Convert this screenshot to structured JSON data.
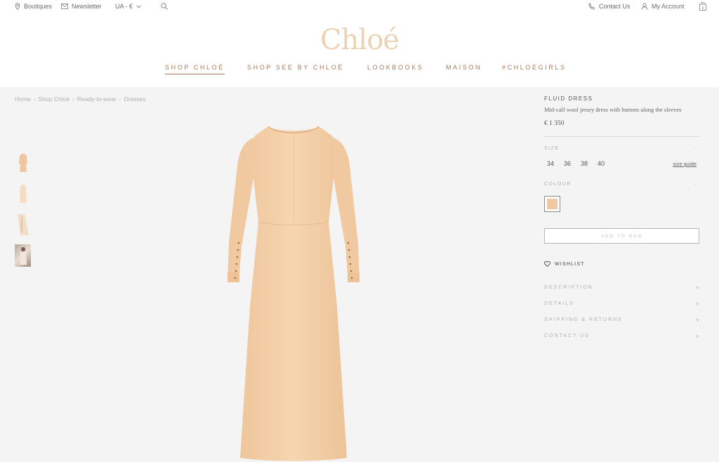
{
  "topbar": {
    "boutiques": "Boutiques",
    "newsletter": "Newsletter",
    "locale": "UA - €",
    "contact": "Contact Us",
    "account": "My Account",
    "bag_count": "0"
  },
  "logo": "Chloé",
  "nav": [
    {
      "label": "SHOP CHLOÉ",
      "active": true
    },
    {
      "label": "SHOP SEE BY CHLOÉ"
    },
    {
      "label": "LOOKBOOKS"
    },
    {
      "label": "MAISON"
    },
    {
      "label": "#CHLOEGIRLS"
    }
  ],
  "breadcrumb": [
    "Home",
    "Shop Chloé",
    "Ready-to-wear",
    "Dresses"
  ],
  "breadcrumb_sep": "›",
  "product": {
    "title": "FLUID DRESS",
    "description": "Mid-calf wool jersey dress with buttons along the sleeves",
    "price": "€ 1 350",
    "size_label": "SIZE",
    "sizes": [
      "34",
      "36",
      "38",
      "40"
    ],
    "size_guide": "size guide",
    "colour_label": "COLOUR",
    "dash": "-",
    "colour_hex": "#f2c8a2",
    "add_to_bag": "ADD TO BAG",
    "wishlist": "WISHLIST",
    "accordion": [
      {
        "label": "DESCRIPTION"
      },
      {
        "label": "DETAILS"
      },
      {
        "label": "SHIPPING & RETURNS"
      },
      {
        "label": "CONTACT US"
      }
    ],
    "plus": "+"
  },
  "colors": {
    "logo": "#ecd3b4",
    "nav": "#a47a5c",
    "dress": "#f5d3ac",
    "background": "#f4f4f5"
  }
}
